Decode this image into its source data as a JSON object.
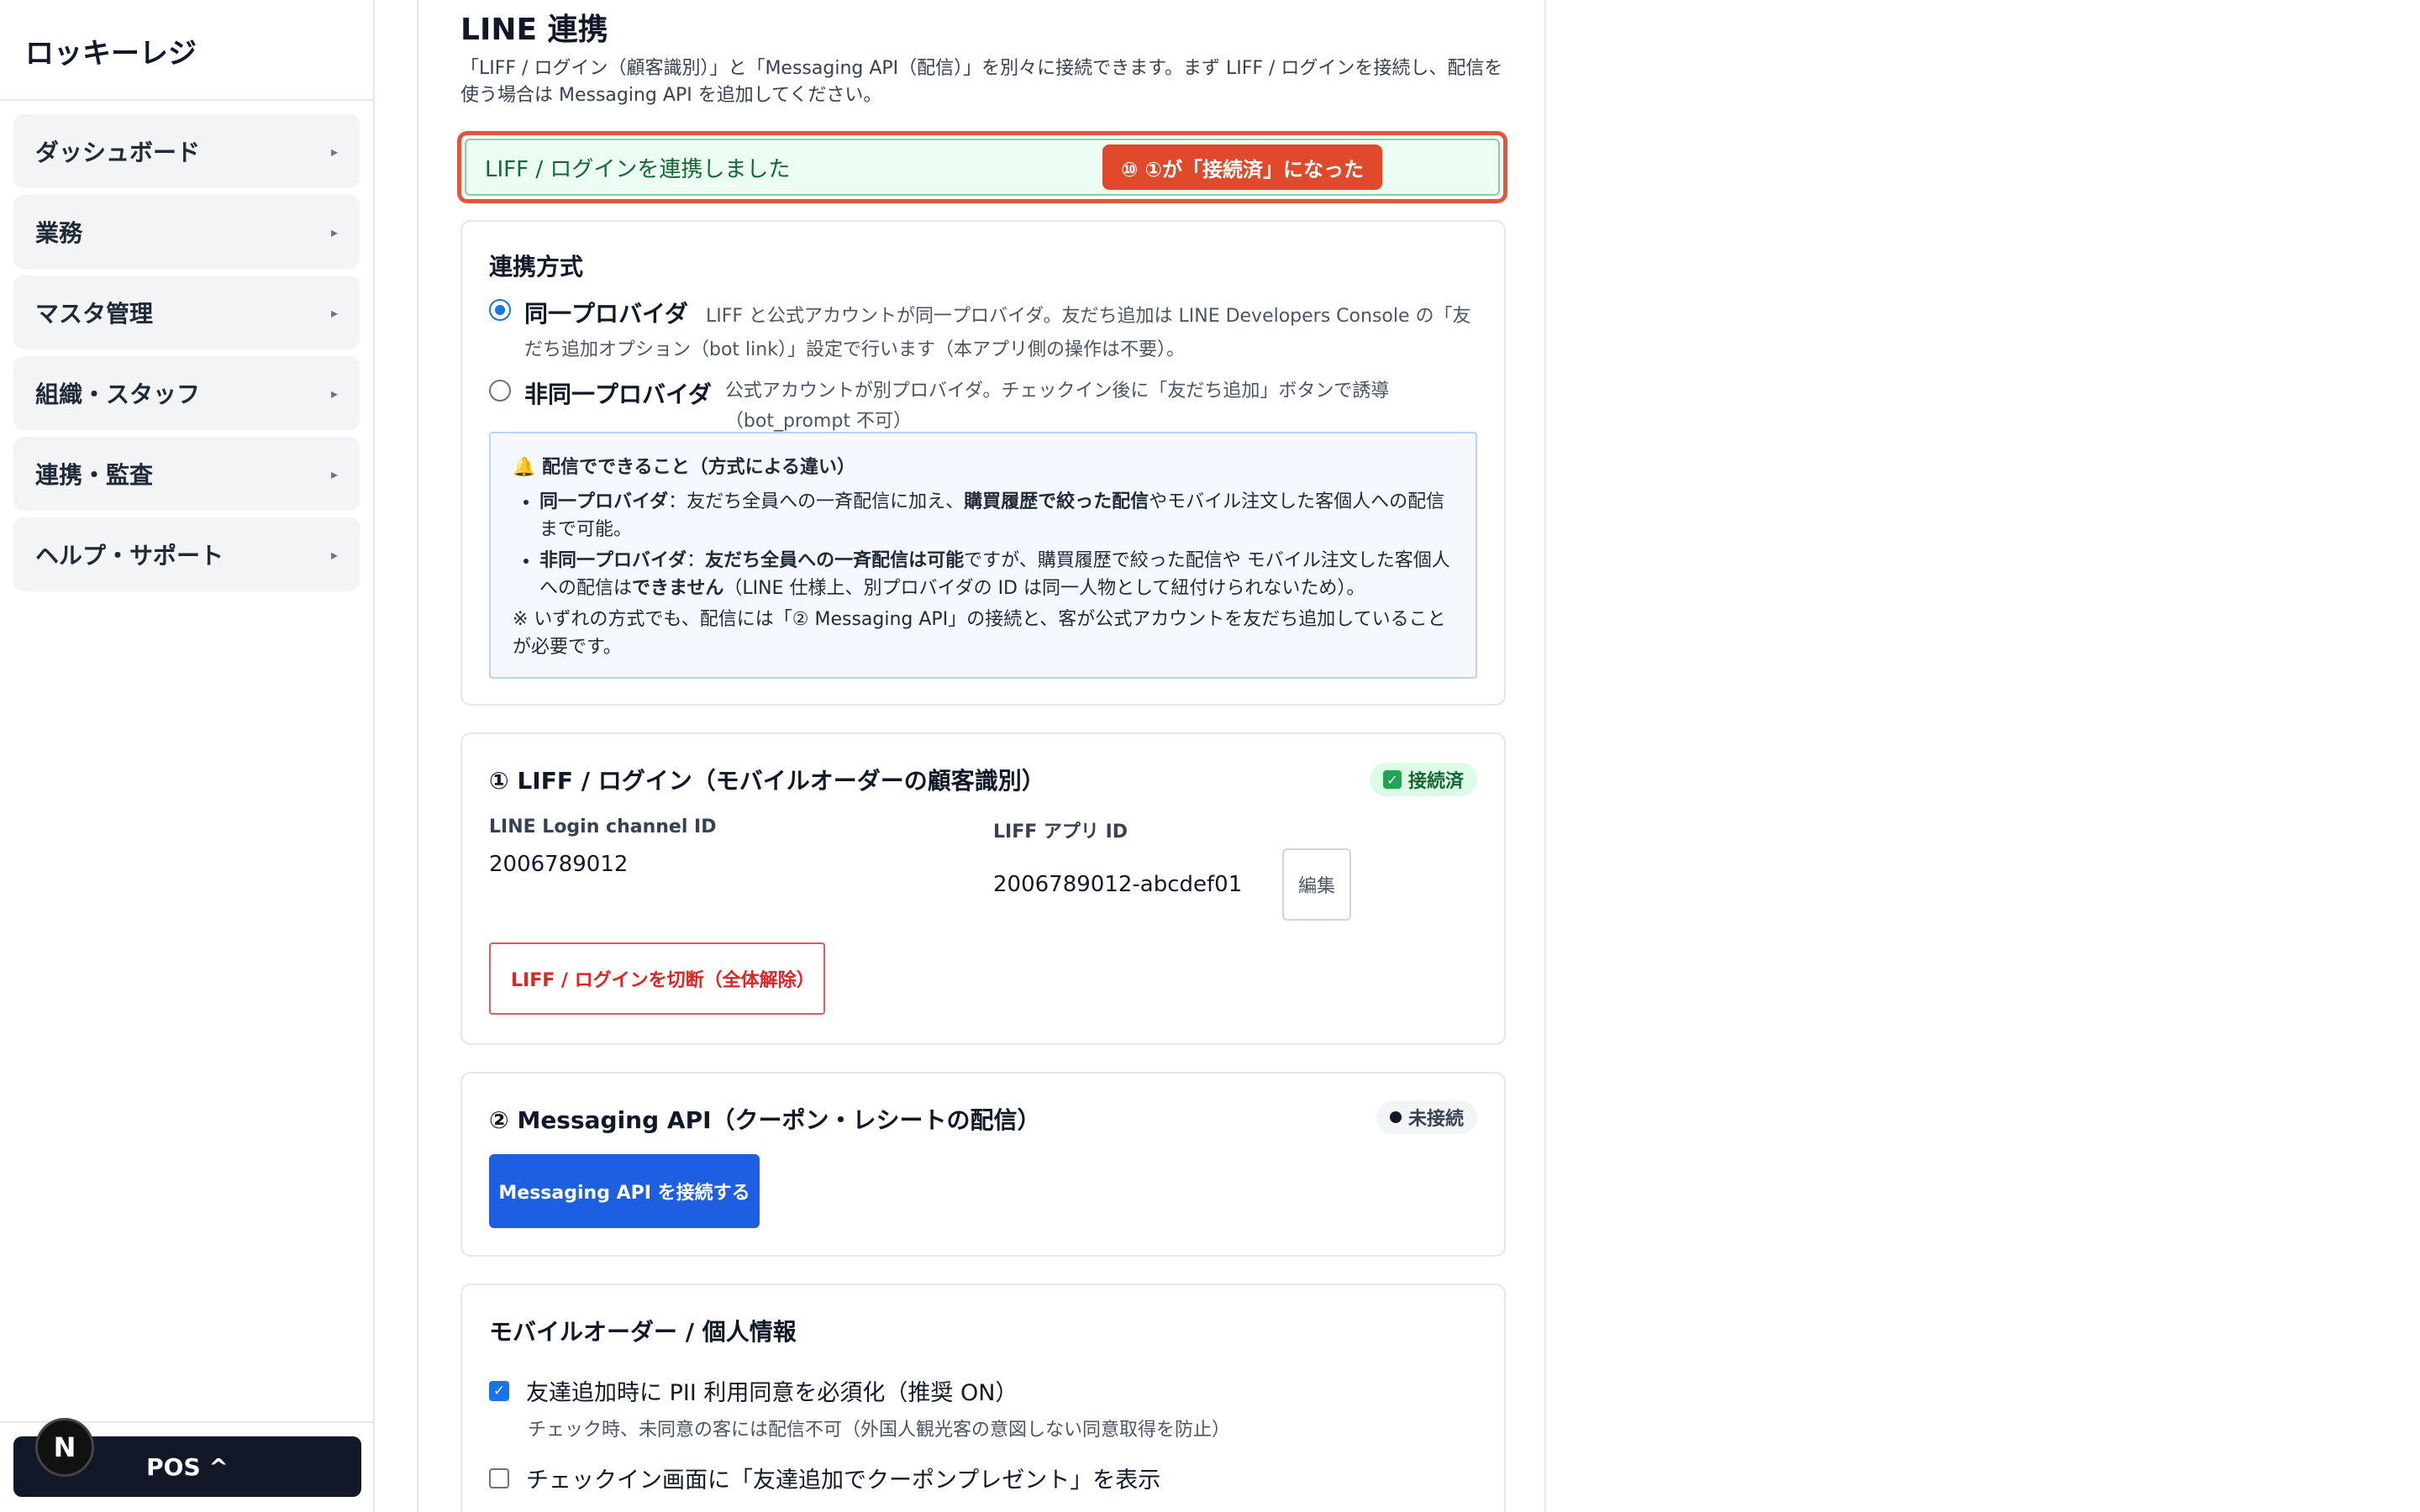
{
  "sidebar": {
    "brand": "ロッキーレジ",
    "items": [
      {
        "label": "ダッシュボード"
      },
      {
        "label": "業務"
      },
      {
        "label": "マスタ管理"
      },
      {
        "label": "組織・スタッフ"
      },
      {
        "label": "連携・監査"
      },
      {
        "label": "ヘルプ・サポート"
      }
    ],
    "caret": "▸",
    "pos_button": "POS ^",
    "next_badge": "N"
  },
  "page": {
    "title": "LINE 連携",
    "description": "「LIFF / ログイン（顧客識別）」と「Messaging API（配信）」を別々に接続できます。まず LIFF / ログインを接続し、配信を使う場合は Messaging API を追加してください。"
  },
  "alert": {
    "text": "LIFF / ログインを連携しました",
    "callout": "⑩ ①が「接続済」になった"
  },
  "method_card": {
    "heading": "連携方式",
    "options": [
      {
        "label": "同一プロバイダ",
        "desc": "LIFF と公式アカウントが同一プロバイダ。友だち追加は LINE Developers Console の「友だち追加オプション（bot link）」設定で行います（本アプリ側の操作は不要）。",
        "selected": true
      },
      {
        "label": "非同一プロバイダ",
        "desc": "公式アカウントが別プロバイダ。チェックイン後に「友だち追加」ボタンで誘導（bot_prompt 不可）",
        "selected": false
      }
    ],
    "info": {
      "title": "🔔 配信でできること（方式による違い）",
      "bullets": [
        {
          "strong": "同一プロバイダ",
          "text_a": "：友だち全員への一斉配信に加え、",
          "strong2": "購買履歴で絞った配信",
          "text_b": "やモバイル注文した客個人への配信まで可能。"
        },
        {
          "strong": "非同一プロバイダ",
          "text_a": "：",
          "strong2": "友だち全員への一斉配信は可能",
          "text_b": "ですが、購買履歴で絞った配信や モバイル注文した客個人への配信は",
          "strong3": "できません",
          "text_c": "（LINE 仕様上、別プロバイダの ID は同一人物として紐付けられないため）。"
        }
      ],
      "note": "※ いずれの方式でも、配信には「② Messaging API」の接続と、客が公式アカウントを友だち追加していることが必要です。"
    }
  },
  "liff_card": {
    "heading": "① LIFF / ログイン（モバイルオーダーの顧客識別）",
    "status": "接続済",
    "status_icon": "✓",
    "channel_label": "LINE Login channel ID",
    "channel_value": "2006789012",
    "liff_label": "LIFF アプリ ID",
    "liff_value": "2006789012-abcdef01",
    "edit_label": "編集",
    "disconnect_label": "LIFF / ログインを切断（全体解除）"
  },
  "messaging_card": {
    "heading": "② Messaging API（クーポン・レシートの配信）",
    "status": "未接続",
    "connect_label": "Messaging API を接続する"
  },
  "mobile_card": {
    "heading": "モバイルオーダー / 個人情報",
    "options": [
      {
        "label": "友達追加時に PII 利用同意を必須化（推奨 ON）",
        "help": "チェック時、未同意の客には配信不可（外国人観光客の意図しない同意取得を防止）",
        "checked": true
      },
      {
        "label": "チェックイン画面に「友達追加でクーポンプレゼント」を表示",
        "help": "",
        "checked": false
      }
    ]
  },
  "colors": {
    "accent": "#1d5fe0",
    "callout": "#e04a2b",
    "success_bg": "#ecfdf3",
    "danger": "#dc2626"
  }
}
